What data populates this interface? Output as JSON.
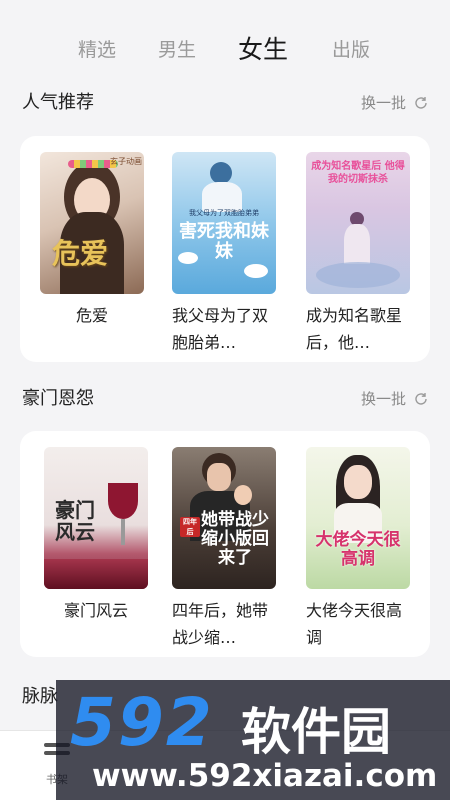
{
  "tabs": [
    "精选",
    "男生",
    "女生",
    "出版"
  ],
  "active_tab": "女生",
  "sections": [
    {
      "title": "人气推荐",
      "refresh_label": "换一批",
      "books": [
        {
          "title": "危爱",
          "cover_text": "危爱",
          "cover_badge": "玄子动画"
        },
        {
          "title": "我父母为了双胞胎弟…",
          "cover_text": "害死我和妹妹",
          "cover_sub": "我父母为了双胞胎弟弟"
        },
        {
          "title": "成为知名歌星后，他…",
          "cover_text": "成为知名歌星后 他得我的切斯抹杀"
        }
      ]
    },
    {
      "title": "豪门恩怨",
      "refresh_label": "换一批",
      "books": [
        {
          "title": "豪门风云",
          "cover_text": "豪门风云"
        },
        {
          "title": "四年后，她带战少缩…",
          "cover_text": "她带战少缩小版回来了",
          "cover_sub": "四年后"
        },
        {
          "title": "大佬今天很高调",
          "cover_text": "大佬今天很高调"
        }
      ]
    },
    {
      "title": "脉脉"
    }
  ],
  "tabbar": {
    "shelf_label": "书架"
  },
  "watermark": {
    "logo": "592",
    "cn": "软件园",
    "url": "www.592xiazai.com"
  },
  "colors": {
    "accent_blue": "#2f8cf0",
    "card_bg": "#ffffff",
    "page_bg": "#f4f4f6"
  }
}
